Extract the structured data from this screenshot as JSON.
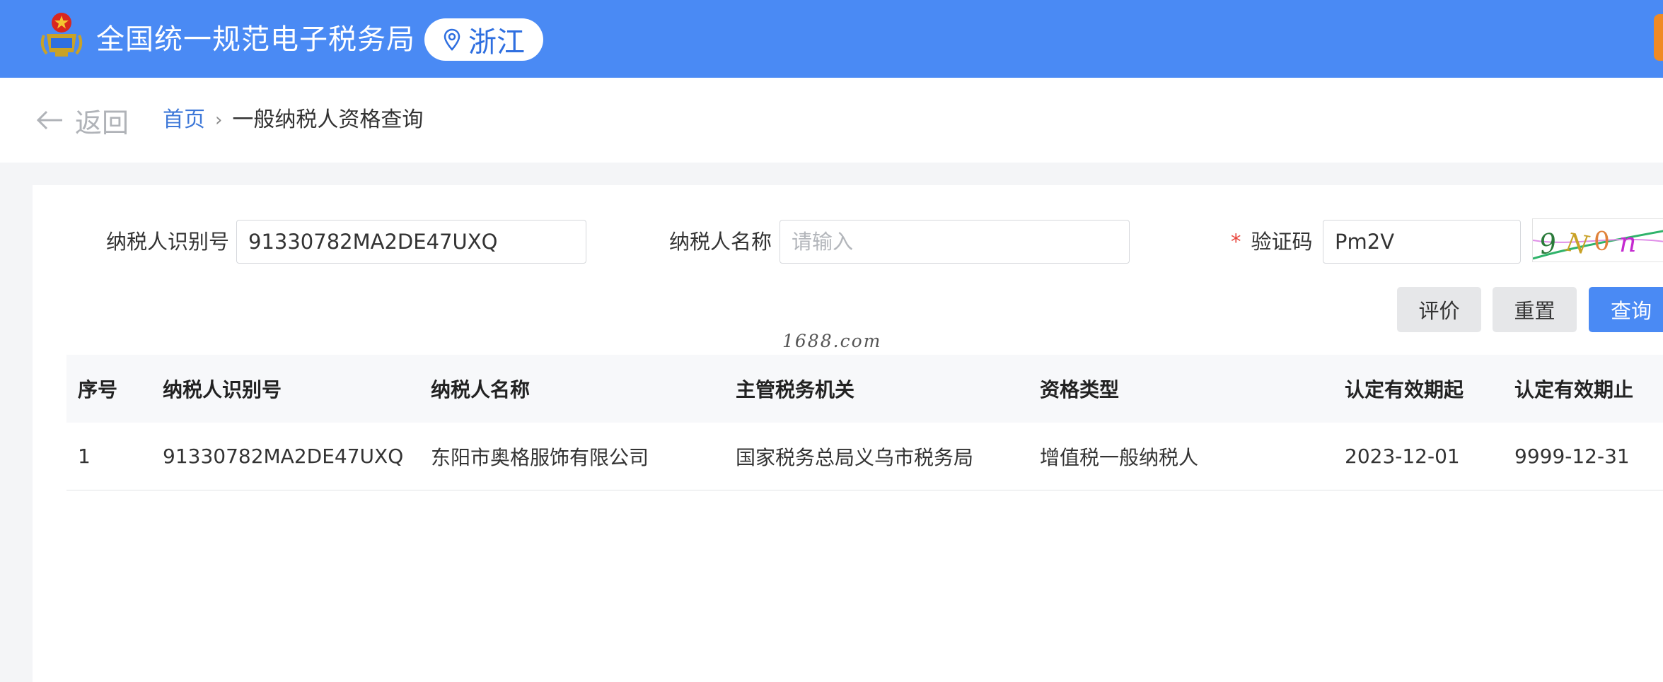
{
  "header": {
    "site_title": "全国统一规范电子税务局",
    "region": "浙江",
    "emblem_text": "中国税务",
    "colors": {
      "bar": "#4a8af4",
      "accent_right": "#f08a24"
    }
  },
  "nav": {
    "back_label": "返回",
    "breadcrumb": {
      "home": "首页",
      "separator": "›",
      "current": "一般纳税人资格查询"
    }
  },
  "form": {
    "taxpayer_id": {
      "label": "纳税人识别号",
      "value": "91330782MA2DE47UXQ",
      "placeholder": ""
    },
    "taxpayer_name": {
      "label": "纳税人名称",
      "value": "",
      "placeholder": "请输入"
    },
    "captcha": {
      "required_mark": "*",
      "label": "验证码",
      "value": "Pm2V",
      "image_text": "9N0n"
    }
  },
  "buttons": {
    "evaluate": "评价",
    "reset": "重置",
    "query": "查询"
  },
  "watermark": "1688.com",
  "table": {
    "columns": [
      "序号",
      "纳税人识别号",
      "纳税人名称",
      "主管税务机关",
      "资格类型",
      "认定有效期起",
      "认定有效期止"
    ],
    "rows": [
      [
        "1",
        "91330782MA2DE47UXQ",
        "东阳市奥格服饰有限公司",
        "国家税务总局义乌市税务局",
        "增值税一般纳税人",
        "2023-12-01",
        "9999-12-31"
      ]
    ]
  }
}
